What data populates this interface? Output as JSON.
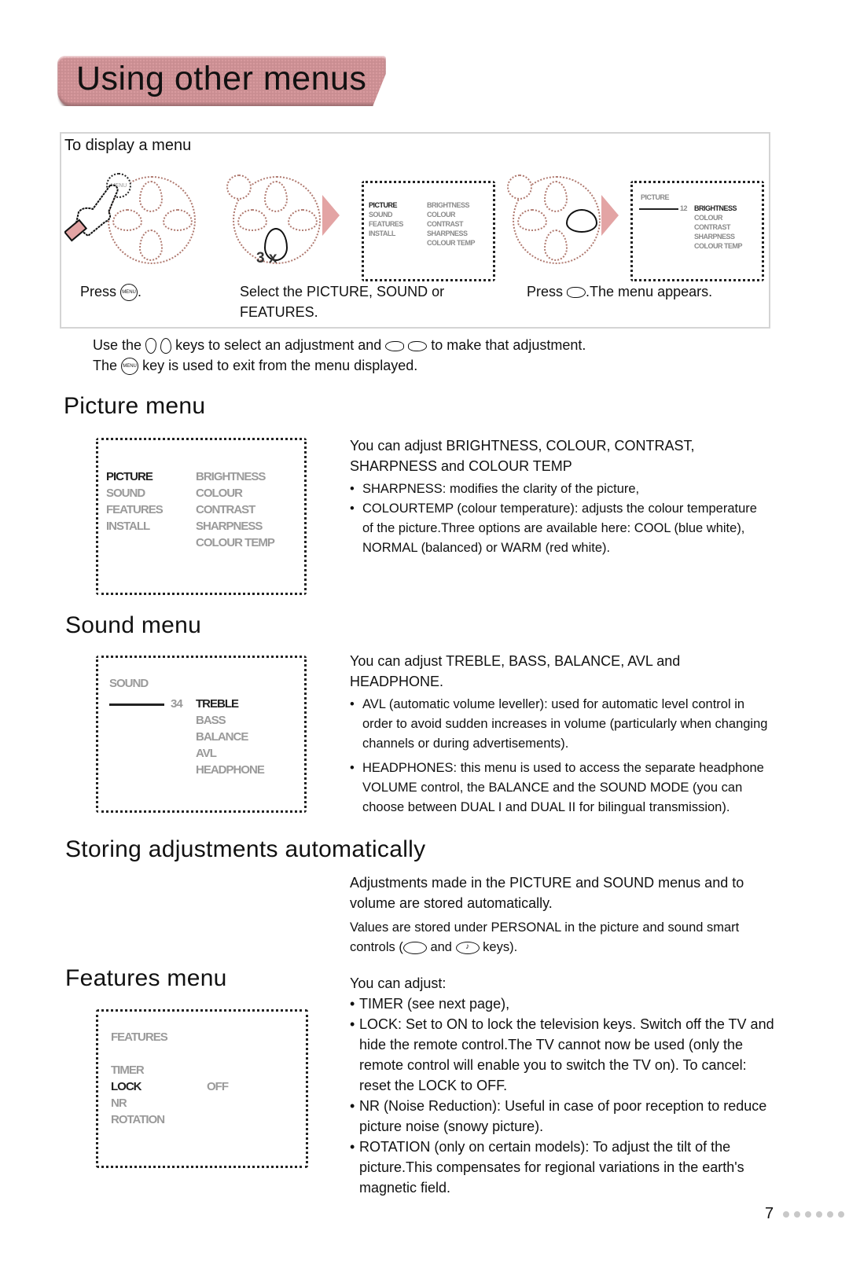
{
  "header": {
    "title": "Using other menus"
  },
  "intro": {
    "heading": "To display a menu",
    "steps": [
      {
        "caption_prefix": "Press",
        "icon": "menu-key-icon",
        "caption_suffix": "."
      },
      {
        "caption": "Select the PICTURE, SOUND or FEATURES.",
        "repeat_label": "3 x"
      },
      {
        "caption_prefix": "Press",
        "icon": "right-key-icon",
        "caption_suffix": ".The menu appears."
      }
    ],
    "step_menu_labels": {
      "menu_key": "MENU",
      "main_left": [
        "PICTURE",
        "SOUND",
        "FEATURES",
        "INSTALL"
      ],
      "main_right": [
        "BRIGHTNESS",
        "COLOUR",
        "CONTRAST",
        "SHARPNESS",
        "COLOUR TEMP"
      ],
      "picture_title": "PICTURE",
      "picture_value": "12",
      "picture_items": [
        "BRIGHTNESS",
        "COLOUR",
        "CONTRAST",
        "SHARPNESS",
        "COLOUR TEMP"
      ]
    }
  },
  "usage": {
    "line1_a": "Use the",
    "line1_b": "keys to select an adjustment and",
    "line1_c": "to make that adjustment.",
    "line2_a": "The",
    "line2_b": "key is used to exit from the menu displayed."
  },
  "picture_menu": {
    "title": "Picture menu",
    "screen_left": [
      "PICTURE",
      "SOUND",
      "FEATURES",
      "INSTALL"
    ],
    "screen_right": [
      "BRIGHTNESS",
      "COLOUR",
      "CONTRAST",
      "SHARPNESS",
      "COLOUR TEMP"
    ],
    "intro": "You can adjust BRIGHTNESS, COLOUR, CONTRAST, SHARPNESS and COLOUR TEMP",
    "bullets": [
      "SHARPNESS: modifies the clarity of the picture,",
      "COLOURTEMP (colour temperature): adjusts the colour temperature of the picture.Three options are available here: COOL (blue white), NORMAL (balanced) or WARM (red white)."
    ]
  },
  "sound_menu": {
    "title": "Sound menu",
    "screen_title": "SOUND",
    "screen_value": "34",
    "screen_items": [
      "TREBLE",
      "BASS",
      "BALANCE",
      "AVL",
      "HEADPHONE"
    ],
    "intro": "You can adjust TREBLE, BASS, BALANCE, AVL and HEADPHONE.",
    "bullets": [
      "AVL (automatic volume leveller): used for automatic level control in order to avoid sudden increases in volume (particularly when changing channels or during advertisements).",
      "HEADPHONES: this menu is used to access the separate headphone VOLUME control, the BALANCE and the SOUND MODE (you can choose between DUAL I and DUAL II for bilingual transmission)."
    ]
  },
  "storing": {
    "title": "Storing adjustments automatically",
    "para1": "Adjustments made in the PICTURE and SOUND menus and to volume are stored automatically.",
    "para2_a": "Values are stored under PERSONAL in the picture and sound smart controls (",
    "para2_b": "and",
    "para2_c": "keys)."
  },
  "features_menu": {
    "title": "Features menu",
    "screen_title": "FEATURES",
    "screen_items": [
      "TIMER",
      "LOCK",
      "NR",
      "ROTATION"
    ],
    "screen_lock_value": "OFF",
    "intro": "You can adjust:",
    "bullets": [
      "TIMER (see next page),",
      "LOCK: Set to ON to lock the television keys. Switch off the TV and hide the remote control.The TV cannot now be used (only the remote control will enable you to switch the TV on). To cancel: reset the LOCK to OFF.",
      "NR (Noise Reduction): Useful in case of poor reception to reduce picture noise (snowy picture).",
      "ROTATION (only on certain models): To adjust the tilt of the picture.This compensates for regional variations in the earth's magnetic field."
    ]
  },
  "footer": {
    "page_number": "7"
  }
}
